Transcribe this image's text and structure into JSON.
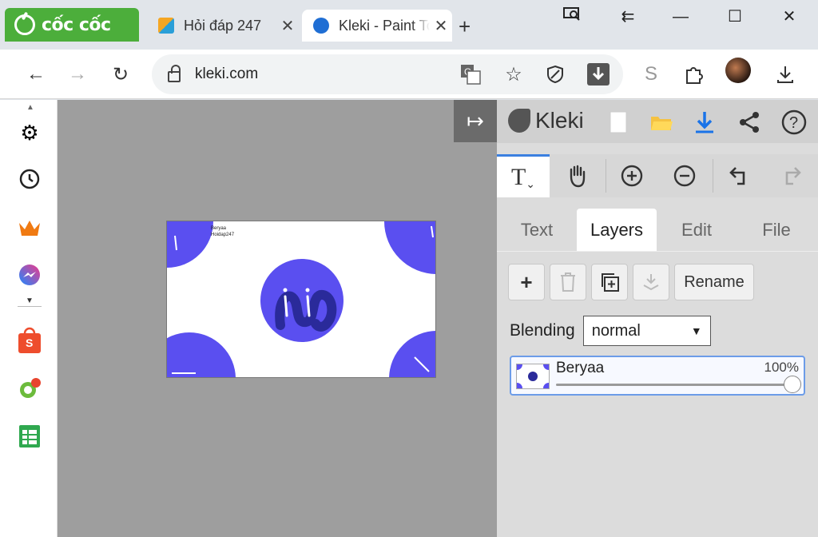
{
  "browser": {
    "brand": "cốc cốc",
    "tabs": [
      {
        "title": "Hỏi đáp 247"
      },
      {
        "title": "Kleki - Paint Tool"
      }
    ],
    "url": "kleki.com"
  },
  "canvas": {
    "text_line1": "Beryaa",
    "text_line2": "Hoidap247"
  },
  "kleki": {
    "brand": "Kleki",
    "tabs": [
      "Text",
      "Layers",
      "Edit",
      "File"
    ],
    "active_tab": "Layers",
    "buttons": {
      "rename": "Rename"
    },
    "blending_label": "Blending",
    "blending_value": "normal",
    "layer": {
      "name": "Beryaa",
      "opacity_label": "100%",
      "opacity": 1.0
    }
  },
  "colors": {
    "accent": "#3b80e0",
    "art_blue": "#5a4ff0",
    "art_dark": "#2a2a9a",
    "brand_green": "#4cae3b"
  }
}
